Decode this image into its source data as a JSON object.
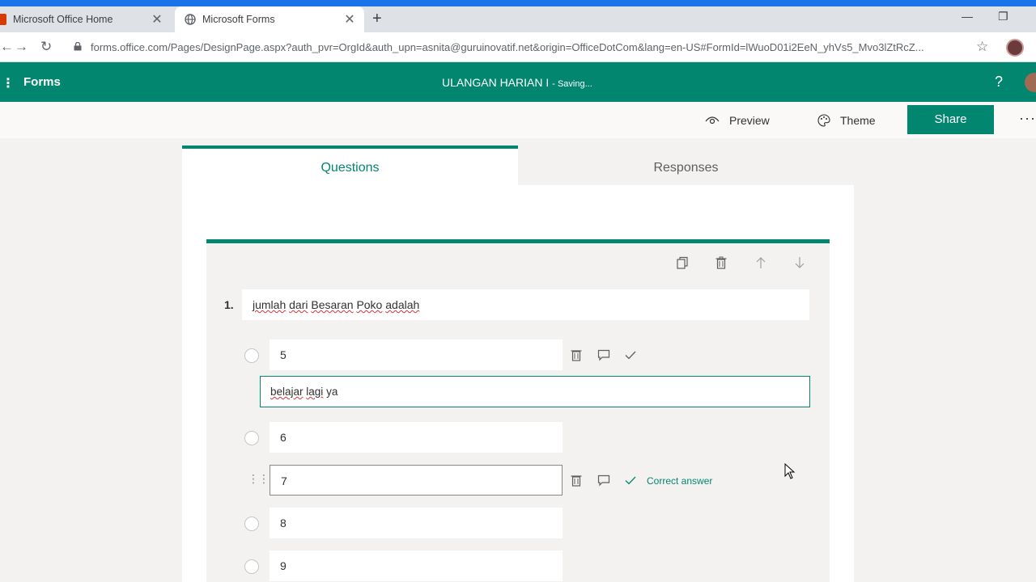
{
  "browser": {
    "tabs": [
      {
        "title": "Microsoft Office Home",
        "close": "✕"
      },
      {
        "title": "Microsoft Forms",
        "close": "✕"
      }
    ],
    "new_tab": "+",
    "url": "forms.office.com/Pages/DesignPage.aspx?auth_pvr=OrgId&auth_upn=asnita@guruinovatif.net&origin=OfficeDotCom&lang=en-US#FormId=lWuoD01i2EeN_yhVs5_Mvo3lZtRcZ..."
  },
  "appbar": {
    "app_name": "Forms",
    "form_title": "ULANGAN HARIAN I",
    "status": "- Saving...",
    "help": "?"
  },
  "commands": {
    "preview": "Preview",
    "theme": "Theme",
    "share": "Share",
    "more": "···"
  },
  "tabs": {
    "questions": "Questions",
    "responses": "Responses"
  },
  "question": {
    "number": "1.",
    "text_words": [
      "jumlah",
      "dari",
      "Besaran",
      "Poko",
      "adalah"
    ],
    "options": [
      {
        "value": "5"
      },
      {
        "value": "6"
      },
      {
        "value": "7"
      },
      {
        "value": "8"
      },
      {
        "value": "9"
      }
    ],
    "feedback_words": [
      "belajar",
      "lagi",
      "ya"
    ],
    "correct_label": "Correct answer"
  },
  "colors": {
    "brand": "#03866f",
    "browser_accent": "#1a73e8"
  }
}
